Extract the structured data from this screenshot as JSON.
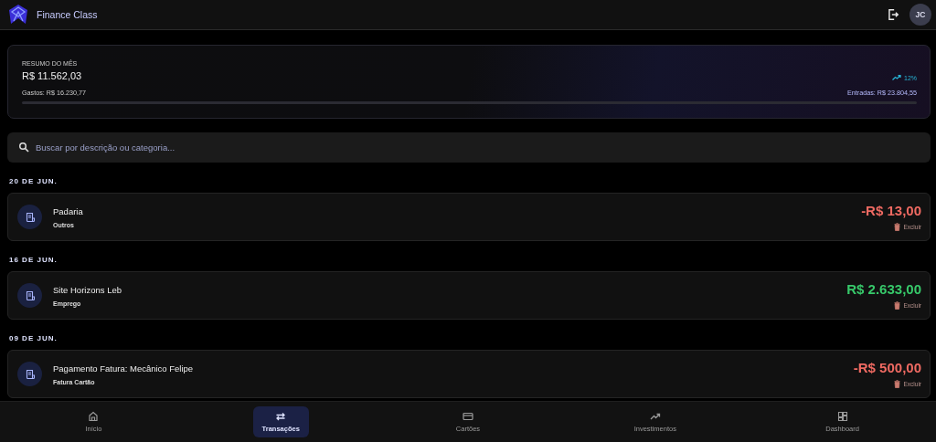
{
  "header": {
    "app_name": "Finance Class",
    "avatar": "JC"
  },
  "summary": {
    "label": "RESUMO DO MÊS",
    "balance": "R$ 11.562,03",
    "trend": "12%",
    "expenses": "Gastos: R$ 16.230,77",
    "income": "Entradas: R$ 23.804,55"
  },
  "search": {
    "placeholder": "Buscar por descrição ou categoria..."
  },
  "groups": [
    {
      "date": "20 DE JUN.",
      "transactions": [
        {
          "title": "Padaria",
          "category": "Outros",
          "amount": "-R$ 13,00",
          "kind": "expense",
          "action": "Excluir"
        }
      ]
    },
    {
      "date": "16 DE JUN.",
      "transactions": [
        {
          "title": "Site Horizons Leb",
          "category": "Emprego",
          "amount": "R$ 2.633,00",
          "kind": "income",
          "action": "Excluir"
        }
      ]
    },
    {
      "date": "09 DE JUN.",
      "transactions": [
        {
          "title": "Pagamento Fatura: Mecânico Felipe",
          "category": "Fatura Cartão",
          "amount": "-R$ 500,00",
          "kind": "expense",
          "action": "Excluir"
        }
      ]
    }
  ],
  "nav": [
    {
      "label": "Início",
      "kind": "home",
      "selected": false
    },
    {
      "label": "Transações",
      "kind": "swap",
      "selected": true
    },
    {
      "label": "Cartões",
      "kind": "card",
      "selected": false
    },
    {
      "label": "Investimentos",
      "kind": "trend",
      "selected": false
    },
    {
      "label": "Dashboard",
      "kind": "dashboard",
      "selected": false
    }
  ]
}
